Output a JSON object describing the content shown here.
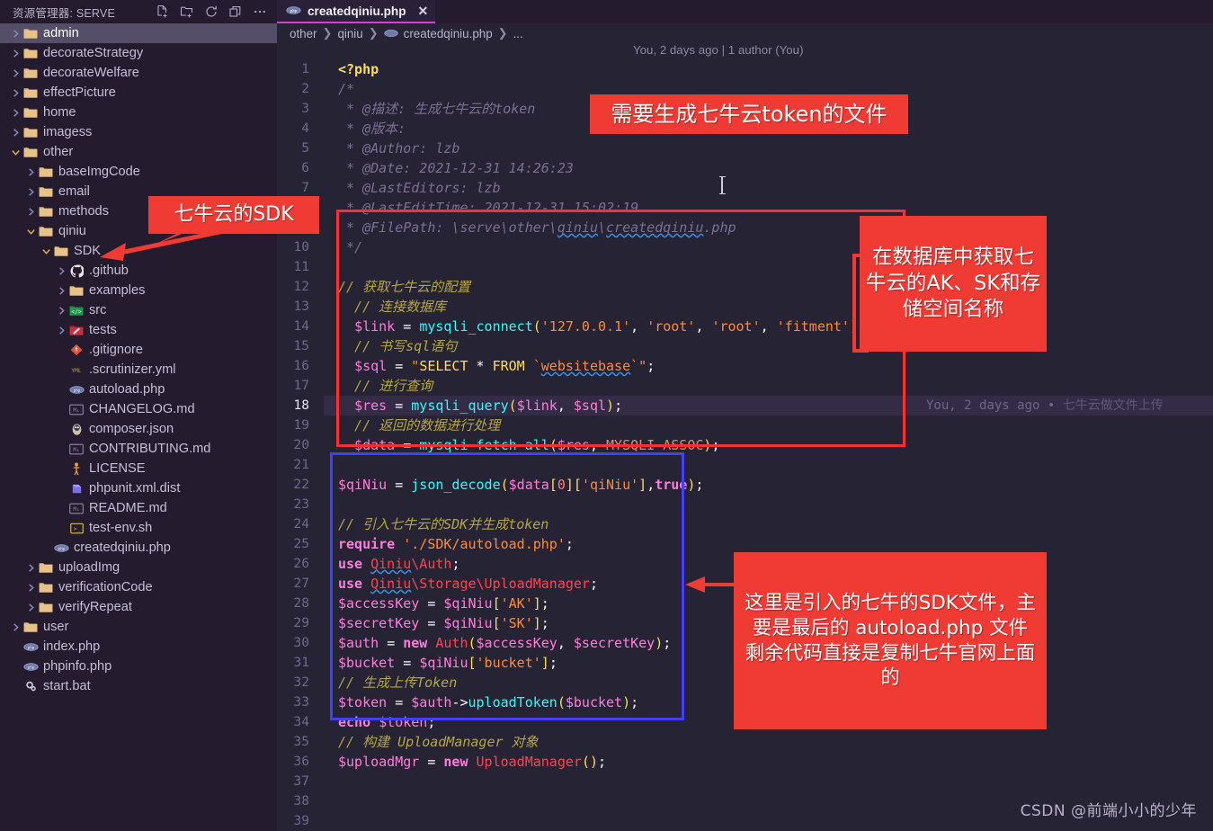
{
  "sidebar": {
    "header_title": "资源管理器: SERVE",
    "actions": [
      {
        "name": "new-file-icon",
        "label": "新建文件"
      },
      {
        "name": "new-folder-icon",
        "label": "新建文件夹"
      },
      {
        "name": "refresh-icon",
        "label": "刷新"
      },
      {
        "name": "collapse-all-icon",
        "label": "全部折叠"
      },
      {
        "name": "more-actions-icon",
        "label": "..."
      }
    ],
    "items": [
      {
        "label": "admin",
        "indent": 0,
        "type": "folder",
        "state": "collapsed",
        "selected": true
      },
      {
        "label": "decorateStrategy",
        "indent": 0,
        "type": "folder",
        "state": "collapsed"
      },
      {
        "label": "decorateWelfare",
        "indent": 0,
        "type": "folder",
        "state": "collapsed"
      },
      {
        "label": "effectPicture",
        "indent": 0,
        "type": "folder",
        "state": "collapsed"
      },
      {
        "label": "home",
        "indent": 0,
        "type": "folder",
        "state": "collapsed"
      },
      {
        "label": "imagess",
        "indent": 0,
        "type": "folder",
        "state": "collapsed"
      },
      {
        "label": "other",
        "indent": 0,
        "type": "folder",
        "state": "expanded"
      },
      {
        "label": "baseImgCode",
        "indent": 1,
        "type": "folder",
        "state": "collapsed"
      },
      {
        "label": "email",
        "indent": 1,
        "type": "folder",
        "state": "collapsed"
      },
      {
        "label": "methods",
        "indent": 1,
        "type": "folder",
        "state": "collapsed"
      },
      {
        "label": "qiniu",
        "indent": 1,
        "type": "folder",
        "state": "expanded"
      },
      {
        "label": "SDK",
        "indent": 2,
        "type": "folder",
        "state": "expanded"
      },
      {
        "label": ".github",
        "indent": 3,
        "type": "github",
        "state": "collapsed"
      },
      {
        "label": "examples",
        "indent": 3,
        "type": "folder",
        "state": "collapsed"
      },
      {
        "label": "src",
        "indent": 3,
        "type": "src",
        "state": "collapsed"
      },
      {
        "label": "tests",
        "indent": 3,
        "type": "tests",
        "state": "collapsed"
      },
      {
        "label": ".gitignore",
        "indent": 3,
        "type": "git",
        "state": "file"
      },
      {
        "label": ".scrutinizer.yml",
        "indent": 3,
        "type": "yml",
        "state": "file"
      },
      {
        "label": "autoload.php",
        "indent": 3,
        "type": "php",
        "state": "file"
      },
      {
        "label": "CHANGELOG.md",
        "indent": 3,
        "type": "md",
        "state": "file"
      },
      {
        "label": "composer.json",
        "indent": 3,
        "type": "composer",
        "state": "file"
      },
      {
        "label": "CONTRIBUTING.md",
        "indent": 3,
        "type": "md",
        "state": "file"
      },
      {
        "label": "LICENSE",
        "indent": 3,
        "type": "license",
        "state": "file"
      },
      {
        "label": "phpunit.xml.dist",
        "indent": 3,
        "type": "phpunit",
        "state": "file"
      },
      {
        "label": "README.md",
        "indent": 3,
        "type": "md",
        "state": "file"
      },
      {
        "label": "test-env.sh",
        "indent": 3,
        "type": "sh",
        "state": "file"
      },
      {
        "label": "createdqiniu.php",
        "indent": 2,
        "type": "php",
        "state": "file"
      },
      {
        "label": "uploadImg",
        "indent": 1,
        "type": "folder",
        "state": "collapsed"
      },
      {
        "label": "verificationCode",
        "indent": 1,
        "type": "folder",
        "state": "collapsed"
      },
      {
        "label": "verifyRepeat",
        "indent": 1,
        "type": "folder",
        "state": "collapsed"
      },
      {
        "label": "user",
        "indent": 0,
        "type": "folder",
        "state": "collapsed"
      },
      {
        "label": "index.php",
        "indent": 0,
        "type": "php",
        "state": "file"
      },
      {
        "label": "phpinfo.php",
        "indent": 0,
        "type": "php",
        "state": "file"
      },
      {
        "label": "start.bat",
        "indent": 0,
        "type": "bat",
        "state": "file"
      }
    ]
  },
  "editor": {
    "tab": {
      "label": "createdqiniu.php",
      "close": "✕",
      "icon": "php-icon"
    },
    "breadcrumb": [
      "other",
      "qiniu",
      "createdqiniu.php",
      "..."
    ],
    "blame_header": "You, 2 days ago | 1 author (You)",
    "blame_inline": {
      "author": "You, 2 days ago",
      "bullet": "•",
      "message": "七牛云做文件上传"
    },
    "first_line_number": 1,
    "last_line_number": 39,
    "lines": [
      {
        "n": 1,
        "text": "<?php"
      },
      {
        "n": 2,
        "text": "/*"
      },
      {
        "n": 3,
        "text": " * @描述: 生成七牛云的token"
      },
      {
        "n": 4,
        "text": " * @版本:"
      },
      {
        "n": 5,
        "text": " * @Author: lzb"
      },
      {
        "n": 6,
        "text": " * @Date: 2021-12-31 14:26:23"
      },
      {
        "n": 7,
        "text": " * @LastEditors: lzb"
      },
      {
        "n": 8,
        "text": " * @LastEditTime: 2021-12-31 15:02:19"
      },
      {
        "n": 9,
        "text": " * @FilePath: \\serve\\other\\qiniu\\createdqiniu.php"
      },
      {
        "n": 10,
        "text": " */"
      },
      {
        "n": 11,
        "text": ""
      },
      {
        "n": 12,
        "text": "// 获取七牛云的配置"
      },
      {
        "n": 13,
        "text": "  // 连接数据库"
      },
      {
        "n": 14,
        "text": "  $link = mysqli_connect('127.0.0.1', 'root', 'root', 'fitment');"
      },
      {
        "n": 15,
        "text": "  // 书写sql语句"
      },
      {
        "n": 16,
        "text": "  $sql = \"SELECT * FROM `websitebase`\";"
      },
      {
        "n": 17,
        "text": "  // 进行查询"
      },
      {
        "n": 18,
        "text": "  $res = mysqli_query($link, $sql);",
        "current": true
      },
      {
        "n": 19,
        "text": "  // 返回的数据进行处理"
      },
      {
        "n": 20,
        "text": "  $data = mysqli_fetch_all($res, MYSQLI_ASSOC);"
      },
      {
        "n": 21,
        "text": ""
      },
      {
        "n": 22,
        "text": "$qiNiu = json_decode($data[0]['qiNiu'],true);"
      },
      {
        "n": 23,
        "text": ""
      },
      {
        "n": 24,
        "text": "// 引入七牛云的SDK并生成token"
      },
      {
        "n": 25,
        "text": "require './SDK/autoload.php';"
      },
      {
        "n": 26,
        "text": "use Qiniu\\Auth;"
      },
      {
        "n": 27,
        "text": "use Qiniu\\Storage\\UploadManager;"
      },
      {
        "n": 28,
        "text": "$accessKey = $qiNiu['AK'];"
      },
      {
        "n": 29,
        "text": "$secretKey = $qiNiu['SK'];"
      },
      {
        "n": 30,
        "text": "$auth = new Auth($accessKey, $secretKey);"
      },
      {
        "n": 31,
        "text": "$bucket = $qiNiu['bucket'];"
      },
      {
        "n": 32,
        "text": "// 生成上传Token"
      },
      {
        "n": 33,
        "text": "$token = $auth->uploadToken($bucket);"
      },
      {
        "n": 34,
        "text": "echo $token;"
      },
      {
        "n": 35,
        "text": "// 构建 UploadManager 对象"
      },
      {
        "n": 36,
        "text": "$uploadMgr = new UploadManager();"
      },
      {
        "n": 37,
        "text": ""
      },
      {
        "n": 38,
        "text": ""
      },
      {
        "n": 39,
        "text": ""
      }
    ]
  },
  "annotations": {
    "callout_top": "需要生成七牛云token的文件",
    "callout_db": "在数据库中获取七牛云的AK、SK和存储空间名称",
    "callout_sdk_code": "这里是引入的七牛的SDK文件，主要是最后的 autoload.php 文件\n剩余代码直接是复制七牛官网上面的",
    "callout_sdk_tree": "七牛云的SDK"
  },
  "watermark": "CSDN @前端小小的少年",
  "colors": {
    "sidebar_bg": "#241b2f",
    "editor_bg": "#262335",
    "selection_bg": "#544e68",
    "tab_accent": "#d043d0",
    "callout_red": "#f03a34",
    "box_red": "#fe2f2f",
    "box_blue": "#4040ff"
  }
}
